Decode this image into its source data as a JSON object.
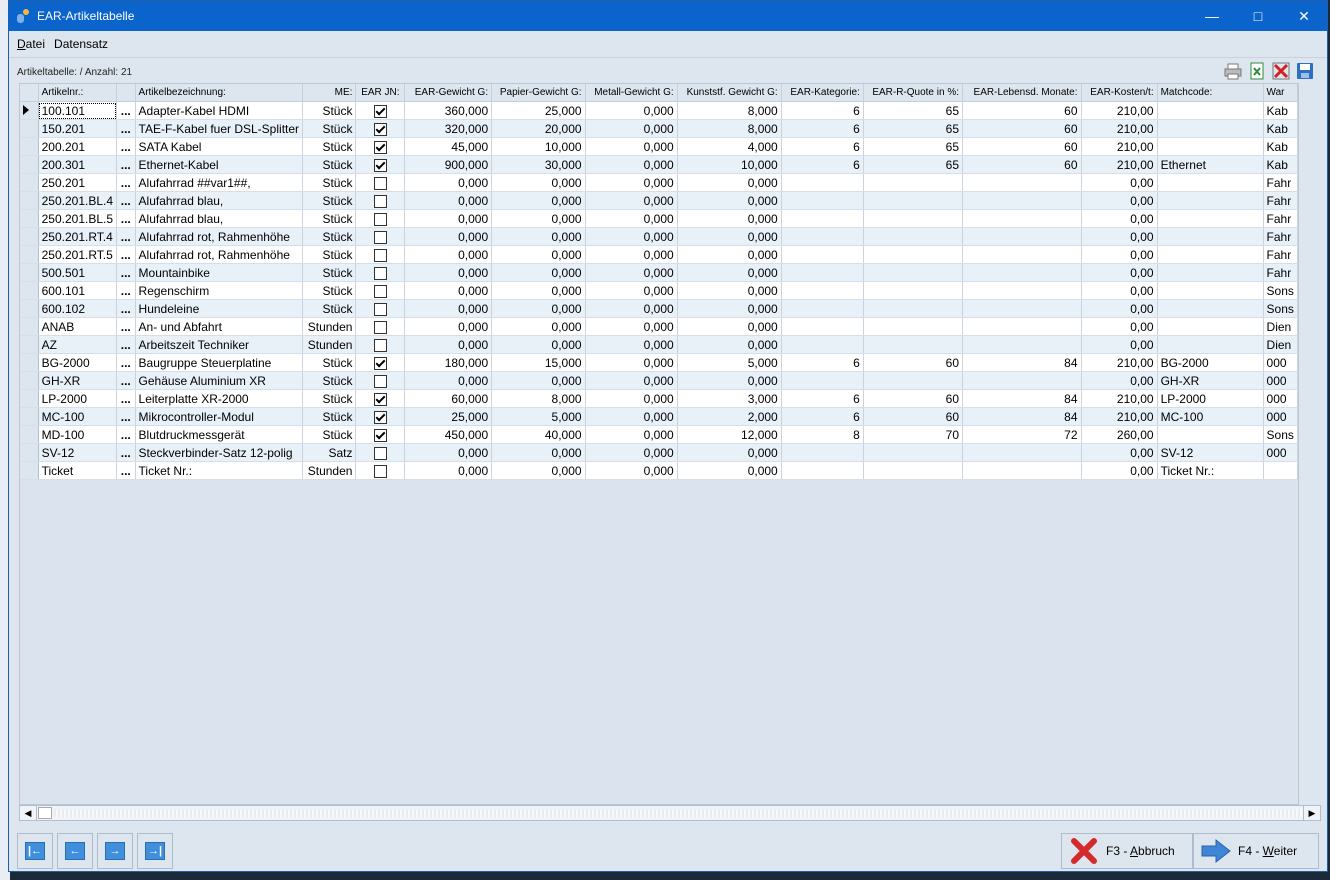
{
  "window": {
    "title": "EAR-Artikeltabelle"
  },
  "menu": {
    "datei": "Datei",
    "datensatz": "Datensatz"
  },
  "info": "Artikeltabelle: / Anzahl: 21",
  "columns": [
    "Artikelnr.:",
    "",
    "Artikelbezeichnung:",
    "ME:",
    "EAR JN:",
    "EAR-Gewicht G:",
    "Papier-Gewicht G:",
    "Metall-Gewicht G:",
    "Kunststf. Gewicht G:",
    "EAR-Kategorie:",
    "EAR-R-Quote in %:",
    "EAR-Lebensd. Monate:",
    "EAR-Kosten/t:",
    "Matchcode:",
    "War"
  ],
  "rows": [
    {
      "nr": "100.101",
      "bez": "Adapter-Kabel HDMI",
      "me": "Stück",
      "ear": true,
      "g": "360,000",
      "p": "25,000",
      "m": "0,000",
      "k": "8,000",
      "kat": "6",
      "quote": "65",
      "mon": "60",
      "kost": "210,00",
      "match": "",
      "war": "Kab"
    },
    {
      "nr": "150.201",
      "bez": "TAE-F-Kabel fuer DSL-Splitter",
      "me": "Stück",
      "ear": true,
      "g": "320,000",
      "p": "20,000",
      "m": "0,000",
      "k": "8,000",
      "kat": "6",
      "quote": "65",
      "mon": "60",
      "kost": "210,00",
      "match": "",
      "war": "Kab"
    },
    {
      "nr": "200.201",
      "bez": "SATA Kabel",
      "me": "Stück",
      "ear": true,
      "g": "45,000",
      "p": "10,000",
      "m": "0,000",
      "k": "4,000",
      "kat": "6",
      "quote": "65",
      "mon": "60",
      "kost": "210,00",
      "match": "",
      "war": "Kab"
    },
    {
      "nr": "200.301",
      "bez": "Ethernet-Kabel",
      "me": "Stück",
      "ear": true,
      "g": "900,000",
      "p": "30,000",
      "m": "0,000",
      "k": "10,000",
      "kat": "6",
      "quote": "65",
      "mon": "60",
      "kost": "210,00",
      "match": "Ethernet",
      "war": "Kab"
    },
    {
      "nr": "250.201",
      "bez": "Alufahrrad ##var1##,",
      "me": "Stück",
      "ear": false,
      "g": "0,000",
      "p": "0,000",
      "m": "0,000",
      "k": "0,000",
      "kat": "",
      "quote": "",
      "mon": "",
      "kost": "0,00",
      "match": "",
      "war": "Fahr"
    },
    {
      "nr": "250.201.BL.4",
      "bez": "Alufahrrad blau,",
      "me": "Stück",
      "ear": false,
      "g": "0,000",
      "p": "0,000",
      "m": "0,000",
      "k": "0,000",
      "kat": "",
      "quote": "",
      "mon": "",
      "kost": "0,00",
      "match": "",
      "war": "Fahr"
    },
    {
      "nr": "250.201.BL.5",
      "bez": "Alufahrrad blau,",
      "me": "Stück",
      "ear": false,
      "g": "0,000",
      "p": "0,000",
      "m": "0,000",
      "k": "0,000",
      "kat": "",
      "quote": "",
      "mon": "",
      "kost": "0,00",
      "match": "",
      "war": "Fahr"
    },
    {
      "nr": "250.201.RT.4",
      "bez": "Alufahrrad rot, Rahmenhöhe",
      "me": "Stück",
      "ear": false,
      "g": "0,000",
      "p": "0,000",
      "m": "0,000",
      "k": "0,000",
      "kat": "",
      "quote": "",
      "mon": "",
      "kost": "0,00",
      "match": "",
      "war": "Fahr"
    },
    {
      "nr": "250.201.RT.5",
      "bez": "Alufahrrad rot, Rahmenhöhe",
      "me": "Stück",
      "ear": false,
      "g": "0,000",
      "p": "0,000",
      "m": "0,000",
      "k": "0,000",
      "kat": "",
      "quote": "",
      "mon": "",
      "kost": "0,00",
      "match": "",
      "war": "Fahr"
    },
    {
      "nr": "500.501",
      "bez": "Mountainbike",
      "me": "Stück",
      "ear": false,
      "g": "0,000",
      "p": "0,000",
      "m": "0,000",
      "k": "0,000",
      "kat": "",
      "quote": "",
      "mon": "",
      "kost": "0,00",
      "match": "",
      "war": "Fahr"
    },
    {
      "nr": "600.101",
      "bez": "Regenschirm",
      "me": "Stück",
      "ear": false,
      "g": "0,000",
      "p": "0,000",
      "m": "0,000",
      "k": "0,000",
      "kat": "",
      "quote": "",
      "mon": "",
      "kost": "0,00",
      "match": "",
      "war": "Sons"
    },
    {
      "nr": "600.102",
      "bez": "Hundeleine",
      "me": "Stück",
      "ear": false,
      "g": "0,000",
      "p": "0,000",
      "m": "0,000",
      "k": "0,000",
      "kat": "",
      "quote": "",
      "mon": "",
      "kost": "0,00",
      "match": "",
      "war": "Sons"
    },
    {
      "nr": "ANAB",
      "bez": "An- und Abfahrt",
      "me": "Stunden",
      "ear": false,
      "g": "0,000",
      "p": "0,000",
      "m": "0,000",
      "k": "0,000",
      "kat": "",
      "quote": "",
      "mon": "",
      "kost": "0,00",
      "match": "",
      "war": "Dien"
    },
    {
      "nr": "AZ",
      "bez": "Arbeitszeit Techniker",
      "me": "Stunden",
      "ear": false,
      "g": "0,000",
      "p": "0,000",
      "m": "0,000",
      "k": "0,000",
      "kat": "",
      "quote": "",
      "mon": "",
      "kost": "0,00",
      "match": "",
      "war": "Dien"
    },
    {
      "nr": "BG-2000",
      "bez": "Baugruppe Steuerplatine",
      "me": "Stück",
      "ear": true,
      "g": "180,000",
      "p": "15,000",
      "m": "0,000",
      "k": "5,000",
      "kat": "6",
      "quote": "60",
      "mon": "84",
      "kost": "210,00",
      "match": "BG-2000",
      "war": "000"
    },
    {
      "nr": "GH-XR",
      "bez": "Gehäuse Aluminium XR",
      "me": "Stück",
      "ear": false,
      "g": "0,000",
      "p": "0,000",
      "m": "0,000",
      "k": "0,000",
      "kat": "",
      "quote": "",
      "mon": "",
      "kost": "0,00",
      "match": "GH-XR",
      "war": "000"
    },
    {
      "nr": "LP-2000",
      "bez": "Leiterplatte XR-2000",
      "me": "Stück",
      "ear": true,
      "g": "60,000",
      "p": "8,000",
      "m": "0,000",
      "k": "3,000",
      "kat": "6",
      "quote": "60",
      "mon": "84",
      "kost": "210,00",
      "match": "LP-2000",
      "war": "000"
    },
    {
      "nr": "MC-100",
      "bez": "Mikrocontroller-Modul",
      "me": "Stück",
      "ear": true,
      "g": "25,000",
      "p": "5,000",
      "m": "0,000",
      "k": "2,000",
      "kat": "6",
      "quote": "60",
      "mon": "84",
      "kost": "210,00",
      "match": "MC-100",
      "war": "000"
    },
    {
      "nr": "MD-100",
      "bez": "Blutdruckmessgerät",
      "me": "Stück",
      "ear": true,
      "g": "450,000",
      "p": "40,000",
      "m": "0,000",
      "k": "12,000",
      "kat": "8",
      "quote": "70",
      "mon": "72",
      "kost": "260,00",
      "match": "",
      "war": "Sons"
    },
    {
      "nr": "SV-12",
      "bez": "Steckverbinder-Satz 12-polig",
      "me": "Satz",
      "ear": false,
      "g": "0,000",
      "p": "0,000",
      "m": "0,000",
      "k": "0,000",
      "kat": "",
      "quote": "",
      "mon": "",
      "kost": "0,00",
      "match": "SV-12",
      "war": "000"
    },
    {
      "nr": "Ticket",
      "bez": "Ticket Nr.:",
      "me": "Stunden",
      "ear": false,
      "g": "0,000",
      "p": "0,000",
      "m": "0,000",
      "k": "0,000",
      "kat": "",
      "quote": "",
      "mon": "",
      "kost": "0,00",
      "match": "Ticket Nr.:",
      "war": ""
    }
  ],
  "ellipsis": "...",
  "buttons": {
    "abbruch_prefix": "F3 - ",
    "abbruch_key": "A",
    "abbruch_rest": "bbruch",
    "weiter_prefix": "F4 - ",
    "weiter_key": "W",
    "weiter_rest": "eiter"
  },
  "icons": {
    "print": "printer-icon",
    "export": "excel-export-icon",
    "delete": "delete-icon",
    "save": "save-icon"
  }
}
